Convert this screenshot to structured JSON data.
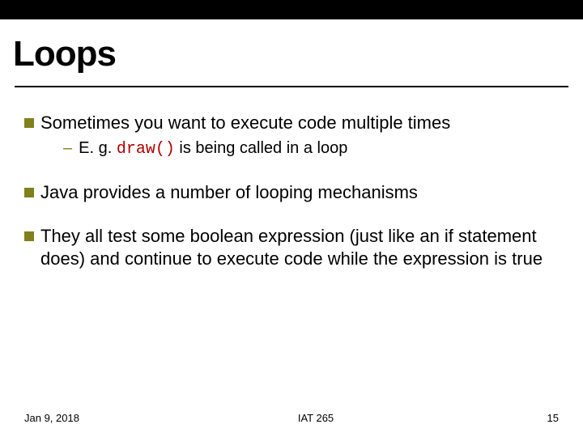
{
  "title": "Loops",
  "bullets": [
    {
      "text": "Sometimes you want to execute code multiple times",
      "sub": {
        "prefix": "E. g. ",
        "code": "draw()",
        "suffix": " is being called in a loop"
      }
    },
    {
      "text": "Java provides a number of looping mechanisms"
    },
    {
      "text": "They all test some boolean expression (just like an if statement does) and continue to execute code while the expression is true"
    }
  ],
  "footer": {
    "date": "Jan 9, 2018",
    "course": "IAT 265",
    "page": "15"
  }
}
